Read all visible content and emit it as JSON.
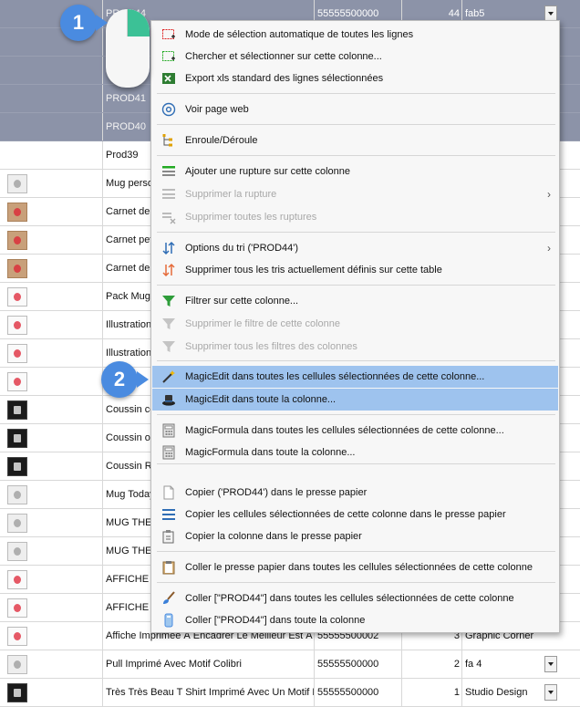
{
  "grid": {
    "rows": [
      {
        "name": "PROD44",
        "ean": "55555500000",
        "qty": "44",
        "supplier": "fab5",
        "thumb": "",
        "selected": true
      },
      {
        "name": "",
        "ean": "",
        "qty": "",
        "supplier": "",
        "thumb": "",
        "selected": true
      },
      {
        "name": "",
        "ean": "",
        "qty": "",
        "supplier": "",
        "thumb": "",
        "selected": true
      },
      {
        "name": "PROD41",
        "ean": "",
        "qty": "",
        "supplier": "",
        "thumb": "",
        "selected": true
      },
      {
        "name": "PROD40",
        "ean": "",
        "qty": "",
        "supplier": "",
        "thumb": "",
        "selected": true
      },
      {
        "name": "Prod39",
        "ean": "",
        "qty": "",
        "supplier": "",
        "thumb": "",
        "selected": false
      },
      {
        "name": "Mug perso",
        "ean": "",
        "qty": "",
        "supplier": "",
        "thumb": "light",
        "selected": false
      },
      {
        "name": "Carnet de n",
        "ean": "",
        "qty": "",
        "supplier": "",
        "thumb": "craft",
        "selected": false
      },
      {
        "name": "Carnet peti",
        "ean": "",
        "qty": "",
        "supplier": "",
        "thumb": "craft",
        "selected": false
      },
      {
        "name": "Carnet de n",
        "ean": "",
        "qty": "",
        "supplier": "",
        "thumb": "craft",
        "selected": false
      },
      {
        "name": "Pack Mug",
        "ean": "",
        "qty": "",
        "supplier": "",
        "thumb": "plain",
        "selected": false
      },
      {
        "name": "Illustration",
        "ean": "",
        "qty": "",
        "supplier": "",
        "thumb": "plain",
        "selected": false
      },
      {
        "name": "Illustration",
        "ean": "",
        "qty": "",
        "supplier": "",
        "thumb": "plain",
        "selected": false
      },
      {
        "name": "",
        "ean": "",
        "qty": "",
        "supplier": "",
        "thumb": "plain",
        "selected": false
      },
      {
        "name": "Coussin co",
        "ean": "",
        "qty": "",
        "supplier": "",
        "thumb": "dark",
        "selected": false
      },
      {
        "name": "Coussin ou",
        "ean": "",
        "qty": "",
        "supplier": "",
        "thumb": "dark",
        "selected": false
      },
      {
        "name": "Coussin Re",
        "ean": "",
        "qty": "",
        "supplier": "",
        "thumb": "dark",
        "selected": false
      },
      {
        "name": "Mug Today",
        "ean": "",
        "qty": "",
        "supplier": "",
        "thumb": "light",
        "selected": false
      },
      {
        "name": "MUG THE",
        "ean": "",
        "qty": "",
        "supplier": "",
        "thumb": "light",
        "selected": false
      },
      {
        "name": "MUG THE",
        "ean": "",
        "qty": "",
        "supplier": "",
        "thumb": "light",
        "selected": false
      },
      {
        "name": "AFFICHE E",
        "ean": "",
        "qty": "",
        "supplier": "",
        "thumb": "plain",
        "selected": false
      },
      {
        "name": "AFFICHE 3",
        "ean": "",
        "qty": "",
        "supplier": "",
        "thumb": "plain",
        "selected": false
      },
      {
        "name": "Affiche Imprimée À Encadrer Le Meilleur Est À Ve",
        "ean": "55555500002",
        "qty": "3",
        "supplier": "Graphic Corner",
        "thumb": "plain",
        "selected": false
      },
      {
        "name": "Pull Imprimé Avec Motif Colibri",
        "ean": "55555500000",
        "qty": "2",
        "supplier": "fa 4",
        "thumb": "light",
        "selected": false
      },
      {
        "name": "Très Très Beau T Shirt Imprimé Avec Un Motif D",
        "ean": "55555500000",
        "qty": "1",
        "supplier": "Studio Design",
        "thumb": "dark",
        "selected": false
      }
    ]
  },
  "menu": {
    "items": [
      {
        "label": "Mode de sélection automatique de toutes les lignes",
        "icon": "select-all-icon",
        "disabled": false
      },
      {
        "label": "Chercher et sélectionner sur cette colonne...",
        "icon": "search-select-icon",
        "disabled": false
      },
      {
        "label": "Export xls standard des lignes sélectionnées",
        "icon": "excel-icon",
        "disabled": false
      },
      {
        "label": "Voir page web",
        "icon": "at-sign-icon",
        "disabled": false
      },
      {
        "label": "Enroule/Déroule",
        "icon": "tree-icon",
        "disabled": false
      },
      {
        "label": "Ajouter une rupture sur cette colonne",
        "icon": "add-break-icon",
        "disabled": false
      },
      {
        "label": "Supprimer la rupture",
        "icon": "remove-break-icon",
        "disabled": true,
        "submenu": true
      },
      {
        "label": "Supprimer toutes les ruptures",
        "icon": "remove-all-breaks-icon",
        "disabled": true
      },
      {
        "label": "Options du tri ('PROD44')",
        "icon": "sort-icon",
        "disabled": false,
        "submenu": true
      },
      {
        "label": "Supprimer tous les tris actuellement définis sur cette table",
        "icon": "remove-sort-icon",
        "disabled": false
      },
      {
        "label": "Filtrer sur cette colonne...",
        "icon": "filter-icon",
        "disabled": false
      },
      {
        "label": "Supprimer le filtre de  cette colonne",
        "icon": "remove-filter-icon",
        "disabled": true
      },
      {
        "label": "Supprimer tous les filtres des colonnes",
        "icon": "remove-all-filters-icon",
        "disabled": true
      },
      {
        "label": "MagicEdit dans toutes les cellules sélectionnées de cette colonne...",
        "icon": "magic-wand-icon",
        "disabled": false,
        "highlighted": true
      },
      {
        "label": "MagicEdit dans toute la colonne...",
        "icon": "magic-hat-icon",
        "disabled": false,
        "highlighted": true
      },
      {
        "label": "MagicFormula dans toutes les cellules sélectionnées de cette colonne...",
        "icon": "calculator-icon",
        "disabled": false
      },
      {
        "label": "MagicFormula dans toute la colonne...",
        "icon": "calculator-icon",
        "disabled": false
      },
      {
        "label": "Copier ('PROD44') dans le presse papier",
        "icon": "copy-icon",
        "disabled": false
      },
      {
        "label": "Copier les cellules sélectionnées de cette colonne dans le presse papier",
        "icon": "list-copy-icon",
        "disabled": false
      },
      {
        "label": "Copier la colonne dans le presse papier",
        "icon": "column-copy-icon",
        "disabled": false
      },
      {
        "label": "Coller le presse papier dans toutes les cellules sélectionnées de cette colonne",
        "icon": "paste-icon",
        "disabled": false
      },
      {
        "label": "Coller [\"PROD44\"] dans toutes les cellules sélectionnées de cette colonne",
        "icon": "brush-icon",
        "disabled": false
      },
      {
        "label": "Coller [\"PROD44\"] dans toute la colonne",
        "icon": "bucket-icon",
        "disabled": false
      }
    ]
  },
  "callouts": [
    {
      "number": "1"
    },
    {
      "number": "2"
    }
  ],
  "colors": {
    "accent": "#4a8be0",
    "highlight": "#9ec3ee",
    "selected_row": "#8c93a8",
    "mouse_button": "#3cc196"
  }
}
